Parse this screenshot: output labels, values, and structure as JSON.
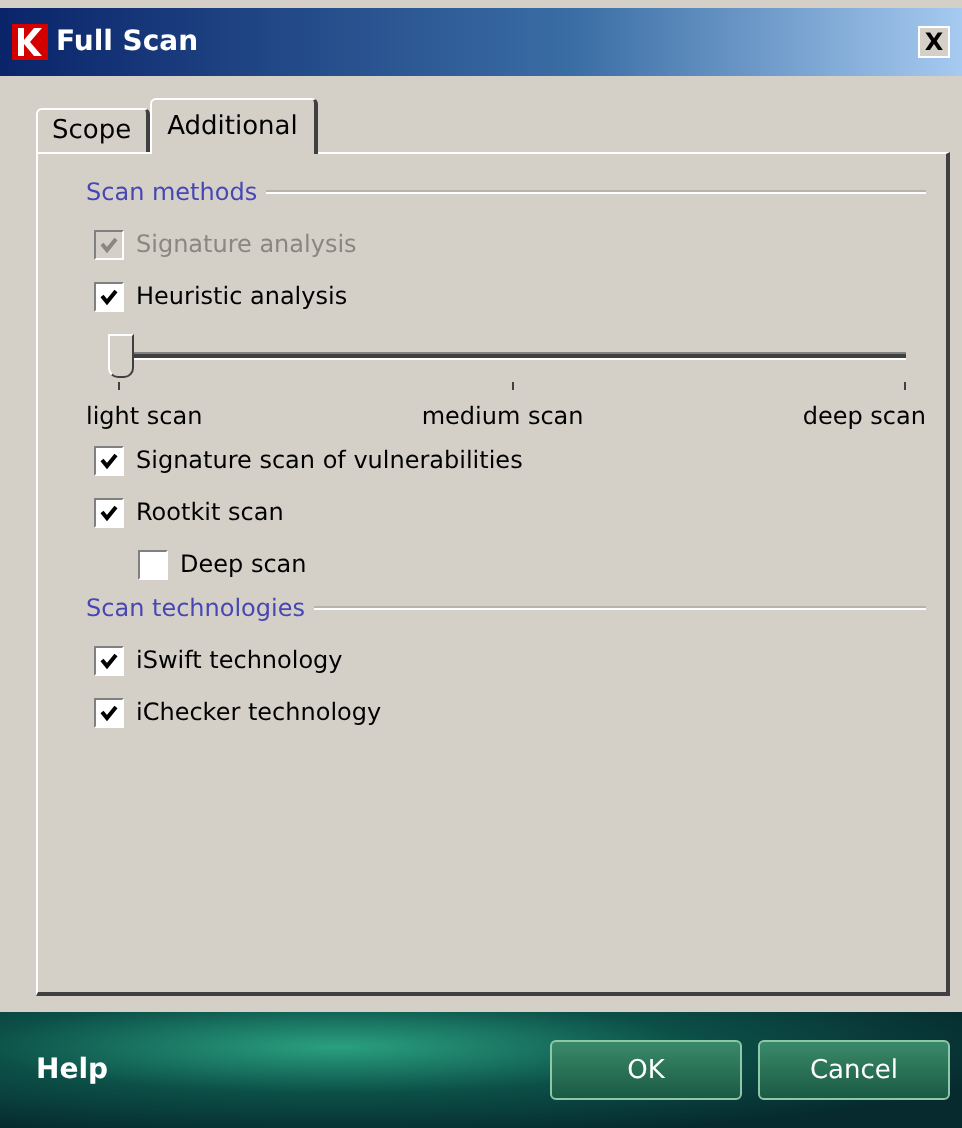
{
  "window": {
    "title": "Full Scan",
    "close": "X"
  },
  "tabs": [
    {
      "label": "Scope",
      "selected": false
    },
    {
      "label": "Additional",
      "selected": true
    }
  ],
  "groups": [
    {
      "title": "Scan methods",
      "items": [
        {
          "kind": "checkbox",
          "label": "Signature analysis",
          "checked": true,
          "disabled": true
        },
        {
          "kind": "checkbox",
          "label": "Heuristic analysis",
          "checked": true,
          "disabled": false
        },
        {
          "kind": "slider",
          "level": 0,
          "ticks": [
            "light scan",
            "medium scan",
            "deep scan"
          ]
        },
        {
          "kind": "checkbox",
          "label": "Signature scan of vulnerabilities",
          "checked": true,
          "disabled": false
        },
        {
          "kind": "checkbox",
          "label": "Rootkit scan",
          "checked": true,
          "disabled": false,
          "children": [
            {
              "kind": "checkbox",
              "label": "Deep scan",
              "checked": false,
              "disabled": false
            }
          ]
        }
      ]
    },
    {
      "title": "Scan technologies",
      "items": [
        {
          "kind": "checkbox",
          "label": "iSwift technology",
          "checked": true,
          "disabled": false
        },
        {
          "kind": "checkbox",
          "label": "iChecker technology",
          "checked": true,
          "disabled": false
        }
      ]
    }
  ],
  "footer": {
    "help": "Help",
    "buttons": [
      "OK",
      "Cancel"
    ]
  }
}
